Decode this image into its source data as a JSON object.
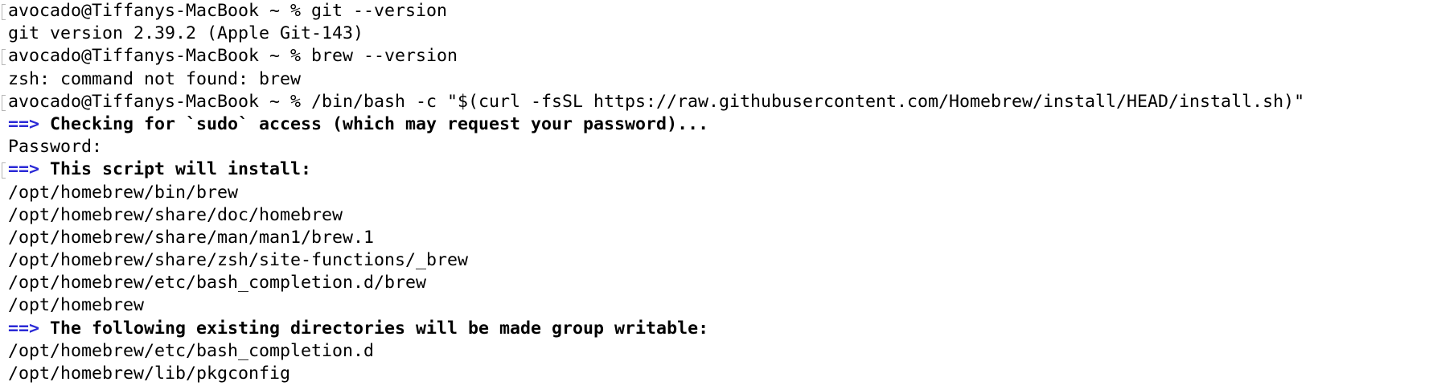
{
  "terminal": {
    "prompt": "avocado@Tiffanys-MacBook ~ % ",
    "arrow": "==>",
    "lines": [
      {
        "type": "command",
        "text": "git --version"
      },
      {
        "type": "output",
        "text": "git version 2.39.2 (Apple Git-143)"
      },
      {
        "type": "command",
        "text": "brew --version"
      },
      {
        "type": "output",
        "text": "zsh: command not found: brew"
      },
      {
        "type": "command",
        "text": "/bin/bash -c \"$(curl -fsSL https://raw.githubusercontent.com/Homebrew/install/HEAD/install.sh)\""
      },
      {
        "type": "heading",
        "text": "Checking for `sudo` access (which may request your password)...",
        "mark": false
      },
      {
        "type": "output",
        "text": "Password:"
      },
      {
        "type": "heading",
        "text": "This script will install:",
        "mark": true
      },
      {
        "type": "output",
        "text": "/opt/homebrew/bin/brew"
      },
      {
        "type": "output",
        "text": "/opt/homebrew/share/doc/homebrew"
      },
      {
        "type": "output",
        "text": "/opt/homebrew/share/man/man1/brew.1"
      },
      {
        "type": "output",
        "text": "/opt/homebrew/share/zsh/site-functions/_brew"
      },
      {
        "type": "output",
        "text": "/opt/homebrew/etc/bash_completion.d/brew"
      },
      {
        "type": "output",
        "text": "/opt/homebrew"
      },
      {
        "type": "heading",
        "text": "The following existing directories will be made group writable:",
        "mark": false
      },
      {
        "type": "output",
        "text": "/opt/homebrew/etc/bash_completion.d"
      },
      {
        "type": "output",
        "text": "/opt/homebrew/lib/pkgconfig"
      }
    ]
  },
  "colors": {
    "arrow": "#2b2ad6",
    "text": "#000000",
    "background": "#ffffff"
  }
}
